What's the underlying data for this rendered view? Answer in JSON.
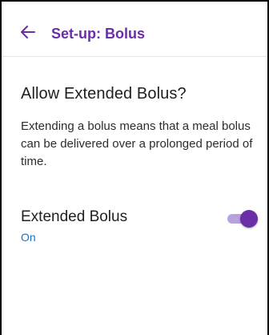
{
  "appbar": {
    "title": "Set-up: Bolus",
    "back_icon": "arrow-left-icon"
  },
  "content": {
    "heading": "Allow Extended Bolus?",
    "description": "Extending a bolus means that a meal bolus can be delivered over a prolonged period of time."
  },
  "setting": {
    "label": "Extended Bolus",
    "value": "On",
    "toggle_on": true
  },
  "colors": {
    "accent": "#6a2ea6",
    "accent_light": "#b9a1dd",
    "value_blue": "#1a73c4"
  }
}
